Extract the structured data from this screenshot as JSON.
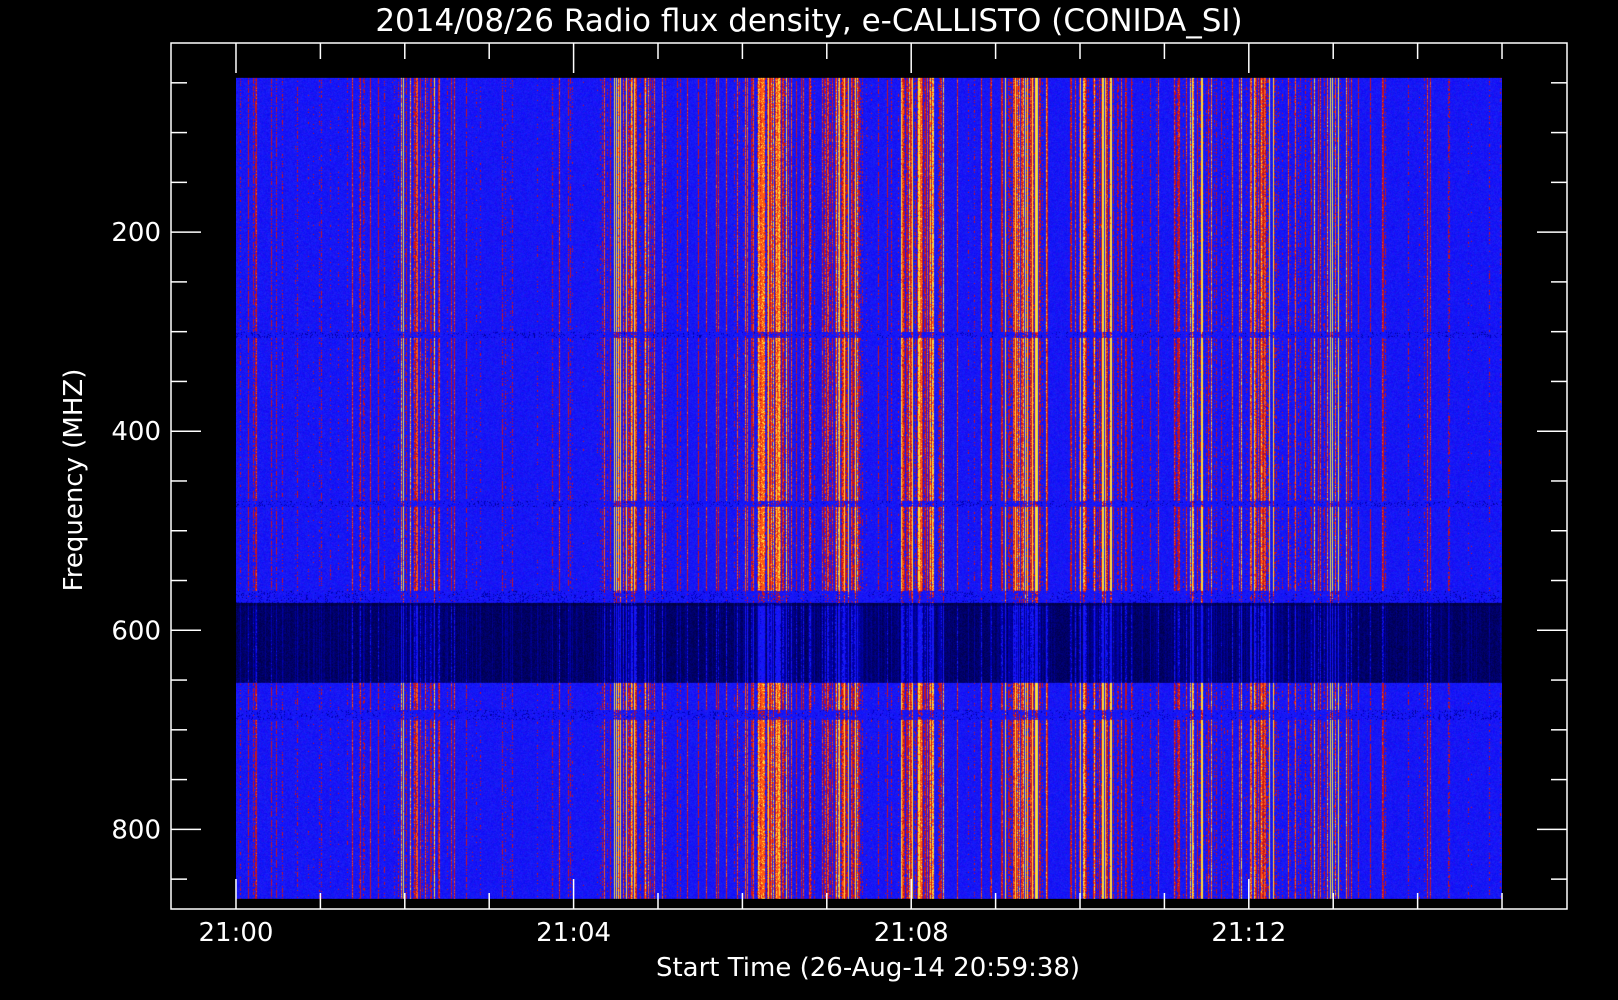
{
  "chart_data": {
    "type": "heatmap",
    "title": "2014/08/26  Radio flux density, e-CALLISTO (CONIDA_SI)",
    "xlabel": "Start Time (26-Aug-14 20:59:38)",
    "ylabel": "Frequency (MHZ)",
    "x_unit": "minutes after 21:00",
    "xlim": [
      -0.77,
      15.77
    ],
    "ylim": [
      880,
      10
    ],
    "data_x_range": [
      0,
      15
    ],
    "data_y_range": [
      45,
      870
    ],
    "x_major_ticks": [
      0,
      4,
      8,
      12
    ],
    "x_tick_labels": [
      "21:00",
      "21:04",
      "21:08",
      "21:12"
    ],
    "x_minor_step": 1,
    "y_major_ticks": [
      200,
      400,
      600,
      800
    ],
    "y_tick_labels": [
      "200",
      "400",
      "600",
      "800"
    ],
    "y_minor_step": 50,
    "grid": false,
    "colormap": [
      "#000000",
      "#0000ff",
      "#1a1aff",
      "#c8141e",
      "#ff5a14",
      "#ffdc3c"
    ],
    "background_color": "#000000",
    "axis_color": "#ffffff"
  }
}
